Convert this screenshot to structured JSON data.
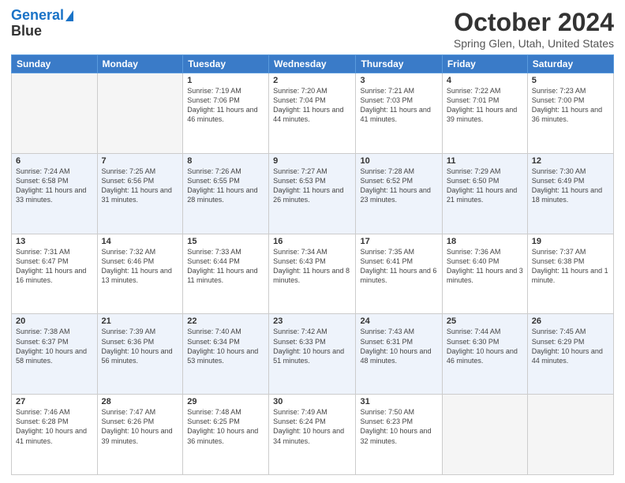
{
  "header": {
    "logo_line1": "General",
    "logo_line2": "Blue",
    "title": "October 2024",
    "subtitle": "Spring Glen, Utah, United States"
  },
  "columns": [
    "Sunday",
    "Monday",
    "Tuesday",
    "Wednesday",
    "Thursday",
    "Friday",
    "Saturday"
  ],
  "weeks": [
    [
      {
        "day": "",
        "info": ""
      },
      {
        "day": "",
        "info": ""
      },
      {
        "day": "1",
        "info": "Sunrise: 7:19 AM\nSunset: 7:06 PM\nDaylight: 11 hours and 46 minutes."
      },
      {
        "day": "2",
        "info": "Sunrise: 7:20 AM\nSunset: 7:04 PM\nDaylight: 11 hours and 44 minutes."
      },
      {
        "day": "3",
        "info": "Sunrise: 7:21 AM\nSunset: 7:03 PM\nDaylight: 11 hours and 41 minutes."
      },
      {
        "day": "4",
        "info": "Sunrise: 7:22 AM\nSunset: 7:01 PM\nDaylight: 11 hours and 39 minutes."
      },
      {
        "day": "5",
        "info": "Sunrise: 7:23 AM\nSunset: 7:00 PM\nDaylight: 11 hours and 36 minutes."
      }
    ],
    [
      {
        "day": "6",
        "info": "Sunrise: 7:24 AM\nSunset: 6:58 PM\nDaylight: 11 hours and 33 minutes."
      },
      {
        "day": "7",
        "info": "Sunrise: 7:25 AM\nSunset: 6:56 PM\nDaylight: 11 hours and 31 minutes."
      },
      {
        "day": "8",
        "info": "Sunrise: 7:26 AM\nSunset: 6:55 PM\nDaylight: 11 hours and 28 minutes."
      },
      {
        "day": "9",
        "info": "Sunrise: 7:27 AM\nSunset: 6:53 PM\nDaylight: 11 hours and 26 minutes."
      },
      {
        "day": "10",
        "info": "Sunrise: 7:28 AM\nSunset: 6:52 PM\nDaylight: 11 hours and 23 minutes."
      },
      {
        "day": "11",
        "info": "Sunrise: 7:29 AM\nSunset: 6:50 PM\nDaylight: 11 hours and 21 minutes."
      },
      {
        "day": "12",
        "info": "Sunrise: 7:30 AM\nSunset: 6:49 PM\nDaylight: 11 hours and 18 minutes."
      }
    ],
    [
      {
        "day": "13",
        "info": "Sunrise: 7:31 AM\nSunset: 6:47 PM\nDaylight: 11 hours and 16 minutes."
      },
      {
        "day": "14",
        "info": "Sunrise: 7:32 AM\nSunset: 6:46 PM\nDaylight: 11 hours and 13 minutes."
      },
      {
        "day": "15",
        "info": "Sunrise: 7:33 AM\nSunset: 6:44 PM\nDaylight: 11 hours and 11 minutes."
      },
      {
        "day": "16",
        "info": "Sunrise: 7:34 AM\nSunset: 6:43 PM\nDaylight: 11 hours and 8 minutes."
      },
      {
        "day": "17",
        "info": "Sunrise: 7:35 AM\nSunset: 6:41 PM\nDaylight: 11 hours and 6 minutes."
      },
      {
        "day": "18",
        "info": "Sunrise: 7:36 AM\nSunset: 6:40 PM\nDaylight: 11 hours and 3 minutes."
      },
      {
        "day": "19",
        "info": "Sunrise: 7:37 AM\nSunset: 6:38 PM\nDaylight: 11 hours and 1 minute."
      }
    ],
    [
      {
        "day": "20",
        "info": "Sunrise: 7:38 AM\nSunset: 6:37 PM\nDaylight: 10 hours and 58 minutes."
      },
      {
        "day": "21",
        "info": "Sunrise: 7:39 AM\nSunset: 6:36 PM\nDaylight: 10 hours and 56 minutes."
      },
      {
        "day": "22",
        "info": "Sunrise: 7:40 AM\nSunset: 6:34 PM\nDaylight: 10 hours and 53 minutes."
      },
      {
        "day": "23",
        "info": "Sunrise: 7:42 AM\nSunset: 6:33 PM\nDaylight: 10 hours and 51 minutes."
      },
      {
        "day": "24",
        "info": "Sunrise: 7:43 AM\nSunset: 6:31 PM\nDaylight: 10 hours and 48 minutes."
      },
      {
        "day": "25",
        "info": "Sunrise: 7:44 AM\nSunset: 6:30 PM\nDaylight: 10 hours and 46 minutes."
      },
      {
        "day": "26",
        "info": "Sunrise: 7:45 AM\nSunset: 6:29 PM\nDaylight: 10 hours and 44 minutes."
      }
    ],
    [
      {
        "day": "27",
        "info": "Sunrise: 7:46 AM\nSunset: 6:28 PM\nDaylight: 10 hours and 41 minutes."
      },
      {
        "day": "28",
        "info": "Sunrise: 7:47 AM\nSunset: 6:26 PM\nDaylight: 10 hours and 39 minutes."
      },
      {
        "day": "29",
        "info": "Sunrise: 7:48 AM\nSunset: 6:25 PM\nDaylight: 10 hours and 36 minutes."
      },
      {
        "day": "30",
        "info": "Sunrise: 7:49 AM\nSunset: 6:24 PM\nDaylight: 10 hours and 34 minutes."
      },
      {
        "day": "31",
        "info": "Sunrise: 7:50 AM\nSunset: 6:23 PM\nDaylight: 10 hours and 32 minutes."
      },
      {
        "day": "",
        "info": ""
      },
      {
        "day": "",
        "info": ""
      }
    ]
  ]
}
